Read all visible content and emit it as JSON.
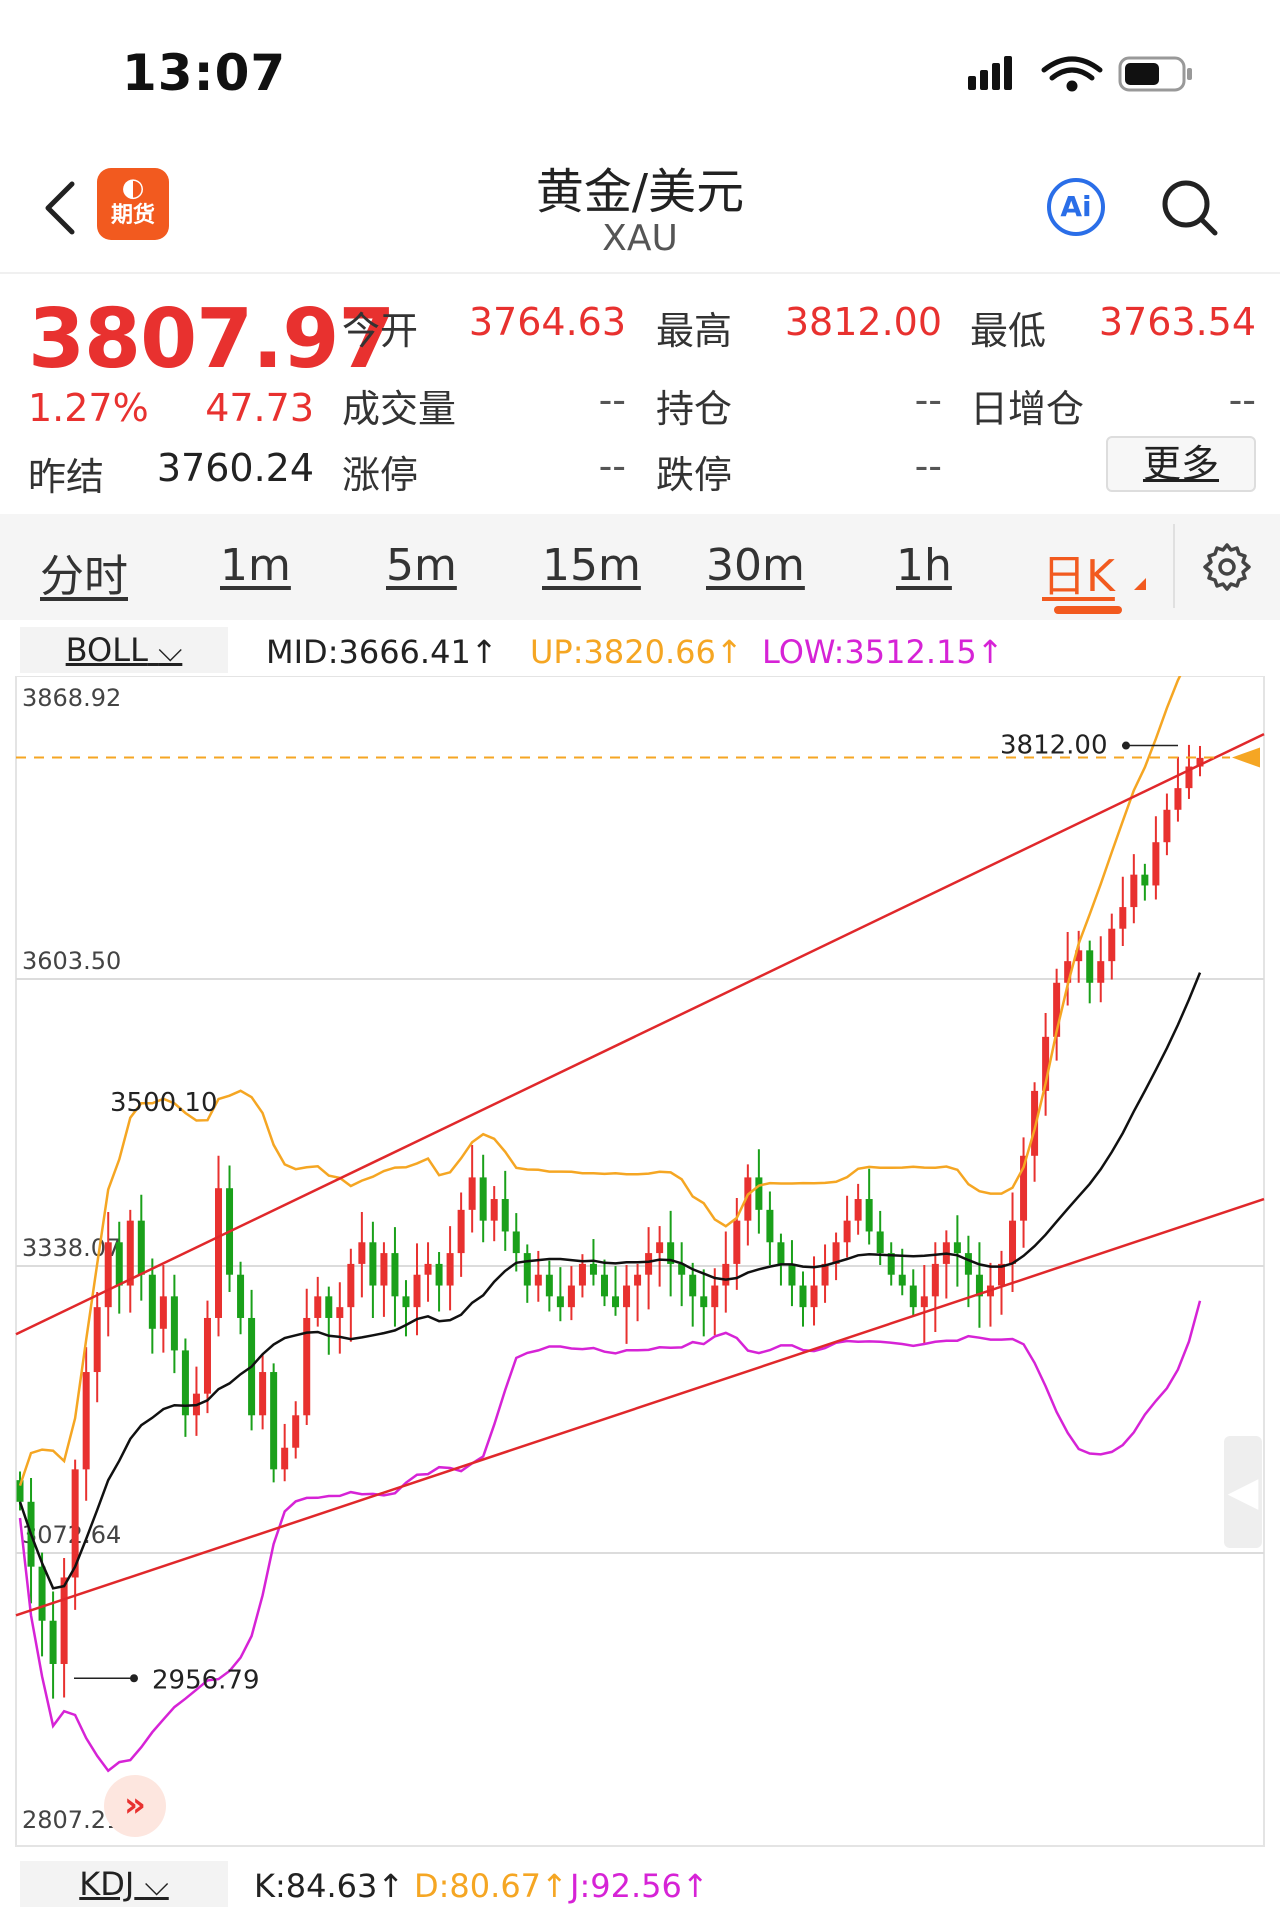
{
  "status_bar": {
    "time": "13:07"
  },
  "header": {
    "title": "黄金/美元",
    "subtitle": "XAU",
    "logo_label": "期货",
    "ai_label": "Ai"
  },
  "quote": {
    "price": "3807.97",
    "change_pct": "1.27%",
    "change": "47.73",
    "prev_close_label": "昨结",
    "prev_close": "3760.24",
    "open_label": "今开",
    "open": "3764.63",
    "high_label": "最高",
    "high": "3812.00",
    "low_label": "最低",
    "low": "3763.54",
    "volume_label": "成交量",
    "volume": "--",
    "position_label": "持仓",
    "position": "--",
    "daily_inc_label": "日增仓",
    "daily_inc": "--",
    "limit_up_label": "涨停",
    "limit_up": "--",
    "limit_down_label": "跌停",
    "limit_down": "--",
    "more_label": "更多"
  },
  "tabs": [
    {
      "label": "分时"
    },
    {
      "label": "1m"
    },
    {
      "label": "5m"
    },
    {
      "label": "15m"
    },
    {
      "label": "30m"
    },
    {
      "label": "1h"
    },
    {
      "label": "日K",
      "active": true
    }
  ],
  "indicator": {
    "name": "BOLL",
    "mid": "MID:3666.41↑",
    "up": "UP:3820.66↑",
    "low": "LOW:3512.15↑"
  },
  "sub_indicator": {
    "name": "KDJ",
    "k": "K:84.63↑",
    "d": "D:80.67↑",
    "j": "J:92.56↑"
  },
  "colors": {
    "up": "#e8312f",
    "down": "#1aa01a",
    "boll_up": "#f5a623",
    "boll_mid": "#111111",
    "boll_low": "#d623d6",
    "accent": "#f25a1f"
  },
  "chart_data": {
    "type": "candlestick",
    "y_ticks": [
      "3868.92",
      "3603.50",
      "3338.07",
      "3072.64",
      "2807.21"
    ],
    "ylim": [
      2807.21,
      3868.92
    ],
    "annotations": {
      "current_high": "3812.00",
      "local_high": "3500.10",
      "local_low": "2956.79"
    },
    "closes": [
      3120,
      3060,
      3010,
      2970,
      3050,
      3150,
      3240,
      3300,
      3360,
      3320,
      3380,
      3330,
      3280,
      3310,
      3260,
      3200,
      3220,
      3290,
      3410,
      3330,
      3290,
      3200,
      3240,
      3150,
      3170,
      3200,
      3290,
      3310,
      3290,
      3300,
      3340,
      3360,
      3320,
      3350,
      3310,
      3300,
      3330,
      3340,
      3320,
      3350,
      3390,
      3420,
      3380,
      3400,
      3370,
      3350,
      3320,
      3330,
      3310,
      3300,
      3320,
      3340,
      3330,
      3310,
      3300,
      3320,
      3330,
      3350,
      3360,
      3340,
      3330,
      3310,
      3300,
      3320,
      3340,
      3380,
      3420,
      3390,
      3360,
      3340,
      3320,
      3300,
      3320,
      3340,
      3360,
      3380,
      3400,
      3370,
      3350,
      3330,
      3320,
      3300,
      3310,
      3340,
      3360,
      3350,
      3330,
      3310,
      3320,
      3340,
      3380,
      3440,
      3500,
      3550,
      3600,
      3620,
      3630,
      3600,
      3620,
      3650,
      3670,
      3700,
      3690,
      3730,
      3760,
      3780,
      3800,
      3808
    ]
  }
}
